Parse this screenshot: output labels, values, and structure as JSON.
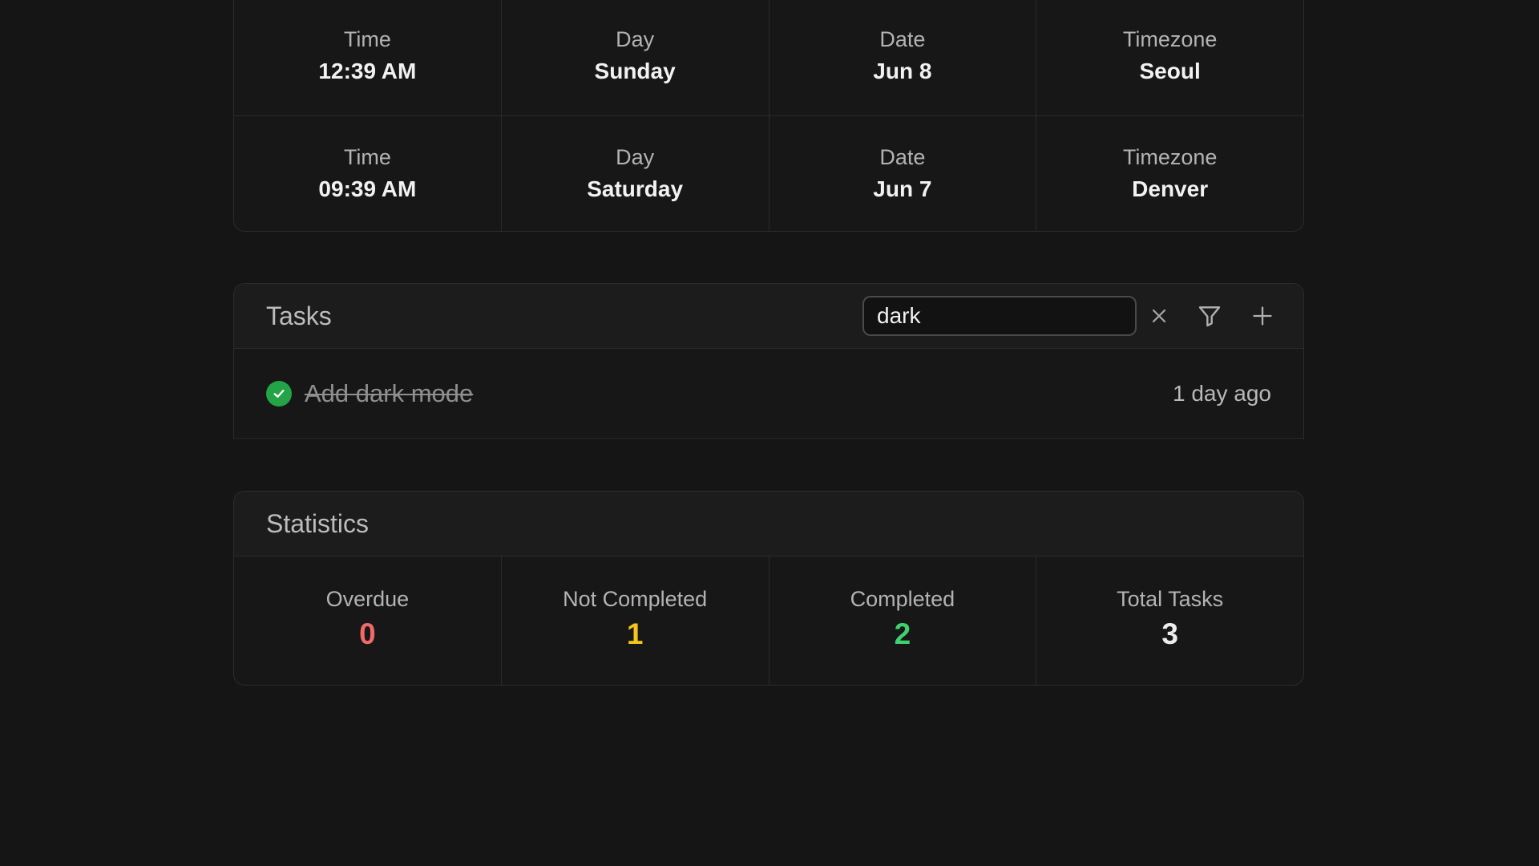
{
  "timezones": [
    {
      "time_label": "Time",
      "time": "12:39 AM",
      "day_label": "Day",
      "day": "Sunday",
      "date_label": "Date",
      "date": "Jun 8",
      "tz_label": "Timezone",
      "tz": "Seoul"
    },
    {
      "time_label": "Time",
      "time": "09:39 AM",
      "day_label": "Day",
      "day": "Saturday",
      "date_label": "Date",
      "date": "Jun 7",
      "tz_label": "Timezone",
      "tz": "Denver"
    }
  ],
  "tasks": {
    "title": "Tasks",
    "search_value": "dark",
    "icons": {
      "clear": "close-icon",
      "filter": "filter-icon",
      "add": "plus-icon"
    },
    "items": [
      {
        "title": "Add dark mode",
        "completed": true,
        "time": "1 day ago"
      }
    ]
  },
  "statistics": {
    "title": "Statistics",
    "items": [
      {
        "label": "Overdue",
        "value": "0",
        "color": "#f06a6a"
      },
      {
        "label": "Not Completed",
        "value": "1",
        "color": "#f5c518"
      },
      {
        "label": "Completed",
        "value": "2",
        "color": "#3fd16f"
      },
      {
        "label": "Total Tasks",
        "value": "3",
        "color": "#ececec"
      }
    ]
  },
  "colors": {
    "background": "#151515",
    "card": "#171717",
    "success": "#22a447"
  }
}
